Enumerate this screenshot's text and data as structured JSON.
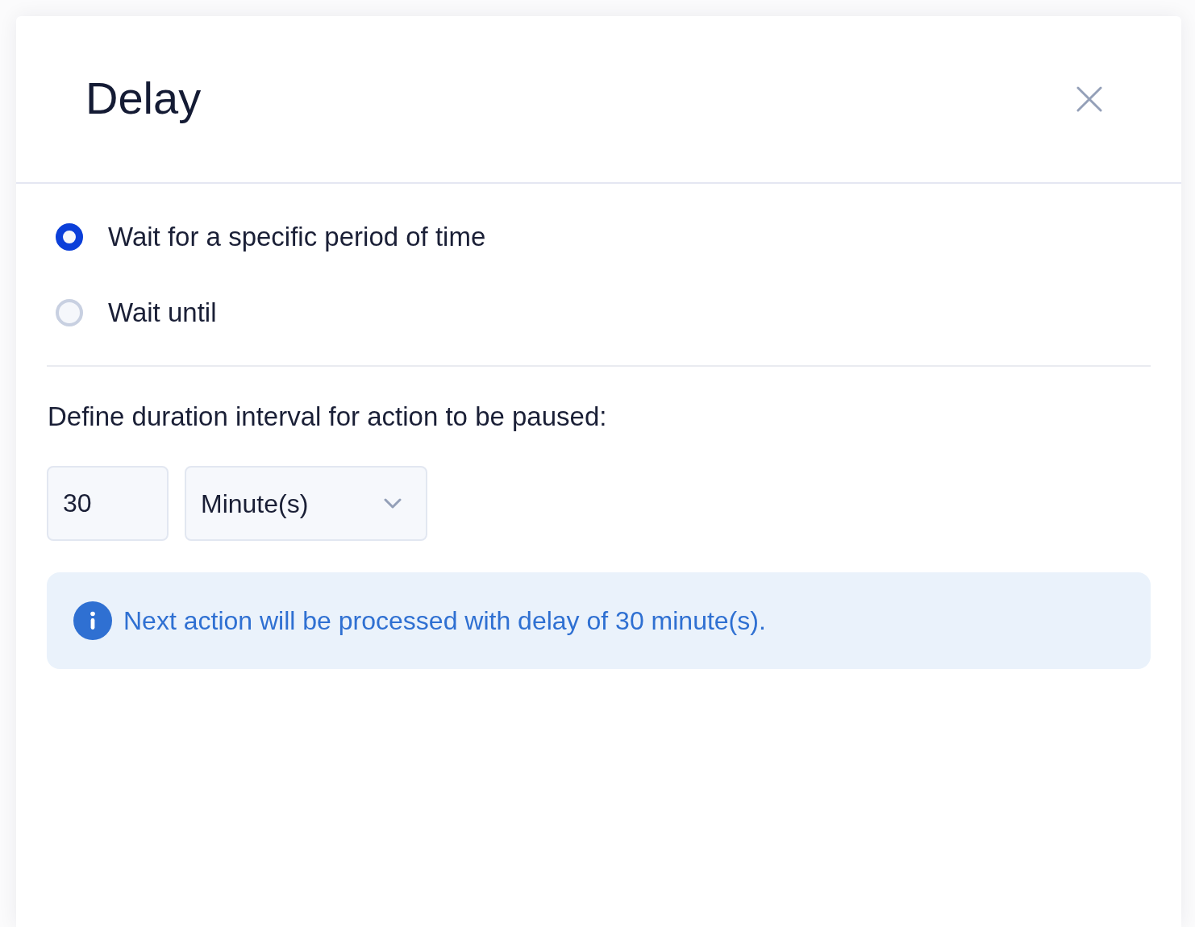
{
  "dialog": {
    "title": "Delay"
  },
  "options": [
    {
      "label": "Wait for a specific period of time",
      "selected": true
    },
    {
      "label": "Wait until",
      "selected": false
    }
  ],
  "duration": {
    "label": "Define duration interval for action to be paused:",
    "amount": "30",
    "unit": "Minute(s)"
  },
  "info": {
    "text": "Next action will be processed with delay of 30 minute(s)."
  }
}
